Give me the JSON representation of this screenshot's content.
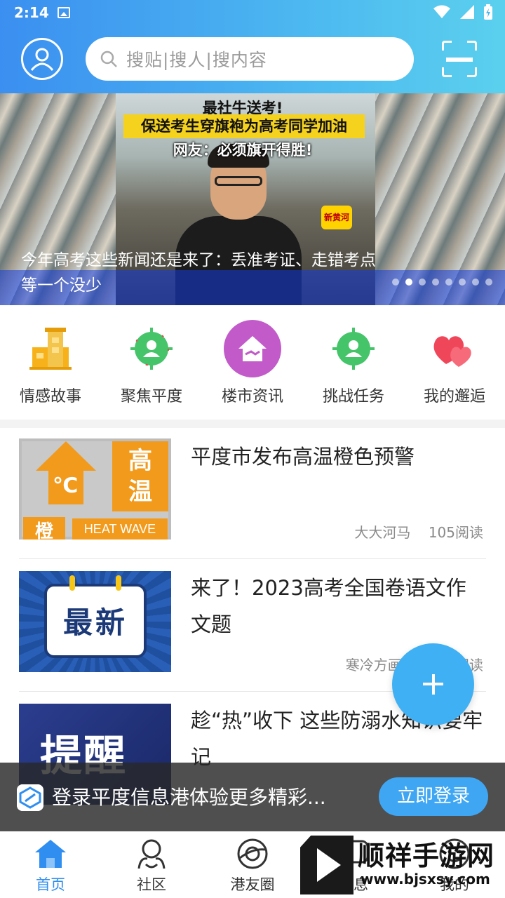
{
  "status_bar": {
    "time": "2:14"
  },
  "search": {
    "placeholder": "搜贴|搜人|搜内容"
  },
  "banner": {
    "headline1": "最社牛送考!",
    "headline2": "保送考生穿旗袍为高考同学加油",
    "headline3": "网友：必须旗开得胜!",
    "source_logo": "新黄河",
    "caption": "今年高考这些新闻还是来了：丢准考证、走错考点等一个没少",
    "slide_count": 8,
    "active_slide": 2
  },
  "categories": [
    {
      "label": "情感故事",
      "icon": "building-icon"
    },
    {
      "label": "聚焦平度",
      "icon": "target-person-icon"
    },
    {
      "label": "楼市资讯",
      "icon": "house-icon"
    },
    {
      "label": "挑战任务",
      "icon": "target-person-icon"
    },
    {
      "label": "我的邂逅",
      "icon": "hearts-icon"
    }
  ],
  "news": [
    {
      "title": "平度市发布高温橙色预警",
      "author": "大大河马",
      "reads": "105阅读",
      "thumb": {
        "top": "高温",
        "unit": "℃",
        "bottom_left": "橙",
        "bottom_right": "HEAT WAVE"
      }
    },
    {
      "title": "来了！2023高考全国卷语文作文题",
      "author": "寒冷方画",
      "reads": "阅读",
      "thumb": {
        "text": "最新"
      }
    },
    {
      "title": "趁“热”收下  这些防溺水知识要牢记",
      "thumb": {
        "text": "提醒"
      }
    }
  ],
  "login_bar": {
    "text": "登录平度信息港体验更多精彩...",
    "button": "立即登录"
  },
  "tabs": [
    {
      "label": "首页",
      "icon": "home-icon",
      "active": true
    },
    {
      "label": "社区",
      "icon": "community-icon",
      "active": false
    },
    {
      "label": "港友圈",
      "icon": "planet-icon",
      "active": false
    },
    {
      "label": "消息",
      "icon": "message-icon",
      "active": false
    },
    {
      "label": "我的",
      "icon": "profile-icon",
      "active": false
    }
  ],
  "watermark": {
    "title": "顺祥手游网",
    "url": "www.bjsxsy.com"
  },
  "colors": {
    "accent": "#3fa6f3",
    "header_start": "#3b8ff0",
    "header_end": "#5bd0ee"
  }
}
